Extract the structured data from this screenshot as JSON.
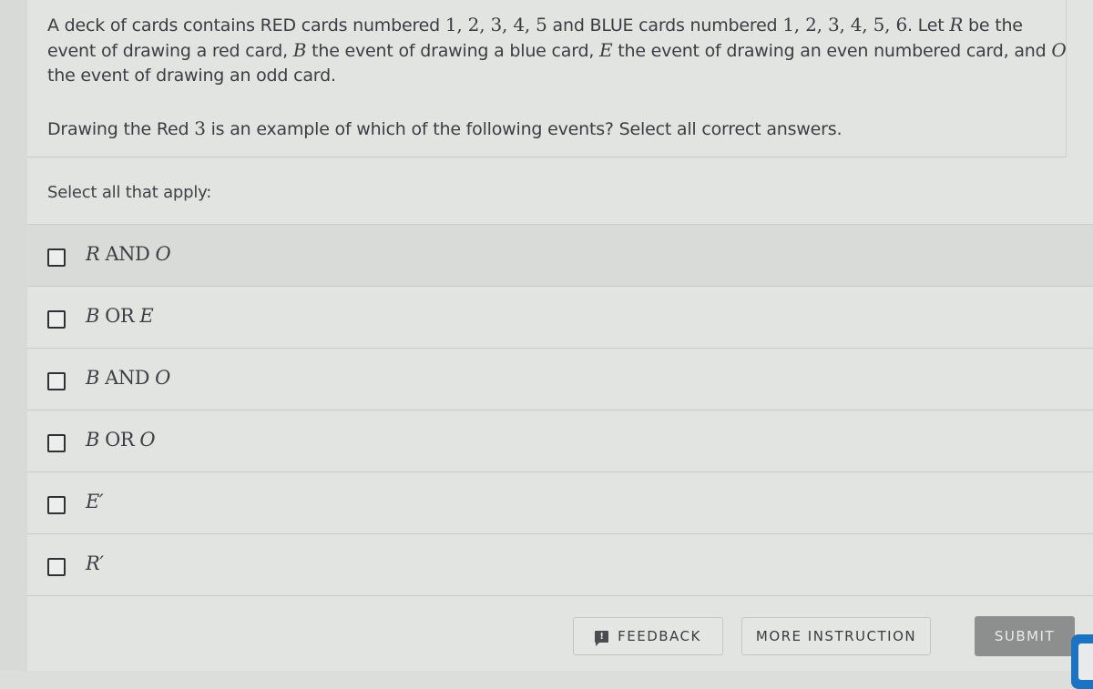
{
  "question": {
    "stem": {
      "p1": "A deck of cards contains RED cards numbered ",
      "red_numbers": "1, 2, 3, 4, 5",
      "p2": " and BLUE cards numbered ",
      "blue_numbers": "1, 2, 3, 4, 5, 6",
      "p3": ". Let ",
      "var_r": "R",
      "p4": " be the event of drawing a red card, ",
      "var_b": "B",
      "p5": " the event of drawing a blue card, ",
      "var_e": "E",
      "p6": " the event of drawing an even numbered card, and ",
      "var_o": "O",
      "p7": " the event of drawing an odd card."
    },
    "prompt": {
      "p1": "Drawing the Red ",
      "number": "3",
      "p2": " is an example of which of the following events? Select all correct answers."
    }
  },
  "instruction": "Select all that apply:",
  "options": [
    {
      "a": "R",
      "op": " AND ",
      "b": "O",
      "checked": false
    },
    {
      "a": "B",
      "op": " OR ",
      "b": "E",
      "checked": false
    },
    {
      "a": "B",
      "op": " AND ",
      "b": "O",
      "checked": false
    },
    {
      "a": "B",
      "op": " OR ",
      "b": "O",
      "checked": false
    },
    {
      "a": "E′",
      "op": "",
      "b": "",
      "checked": false
    },
    {
      "a": "R′",
      "op": "",
      "b": "",
      "checked": false
    }
  ],
  "footer": {
    "feedback_label": "FEEDBACK",
    "feedback_icon": "feedback-icon",
    "more_instruction_label": "MORE INSTRUCTION",
    "submit_label": "SUBMIT"
  },
  "colors": {
    "background": "#e2e4e2",
    "submit_disabled": "#8d8f8f",
    "accent_blue": "#1b73c2"
  }
}
